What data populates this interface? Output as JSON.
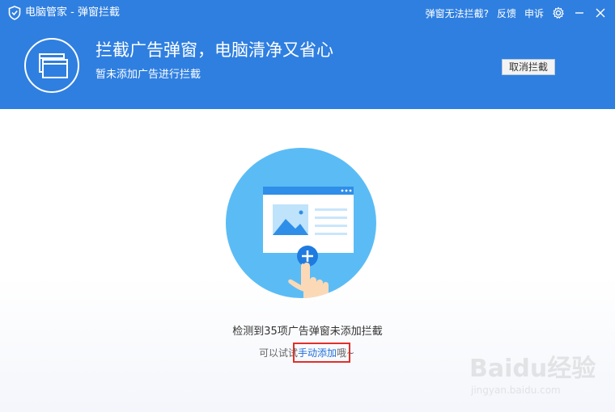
{
  "titlebar": {
    "app_icon": "shield-logo-icon",
    "title": "电脑管家 - 弹窗拦截",
    "links": [
      "弹窗无法拦截?",
      "反馈",
      "申诉"
    ],
    "settings_icon": "gear-icon",
    "minimize_icon": "minimize-icon",
    "close_icon": "close-icon"
  },
  "hero": {
    "icon": "window-icon",
    "title": "拦截广告弹窗，电脑清净又省心",
    "subtitle": "暂未添加广告进行拦截",
    "cancel_button": "取消拦截"
  },
  "main": {
    "illustration": "add-popup-illustration",
    "status_text": "检测到35项广告弹窗未添加拦截",
    "hint_prefix": "可以试试",
    "hint_link": "手动添加",
    "hint_suffix": "哦~"
  },
  "watermark": {
    "brand": "Baidu经验",
    "url": "jingyan.baidu.com"
  },
  "colors": {
    "header_bg": "#2f7fe0",
    "circle_bg": "#5bbcf5",
    "link": "#1e6fd9",
    "highlight_box": "#e0302a"
  }
}
